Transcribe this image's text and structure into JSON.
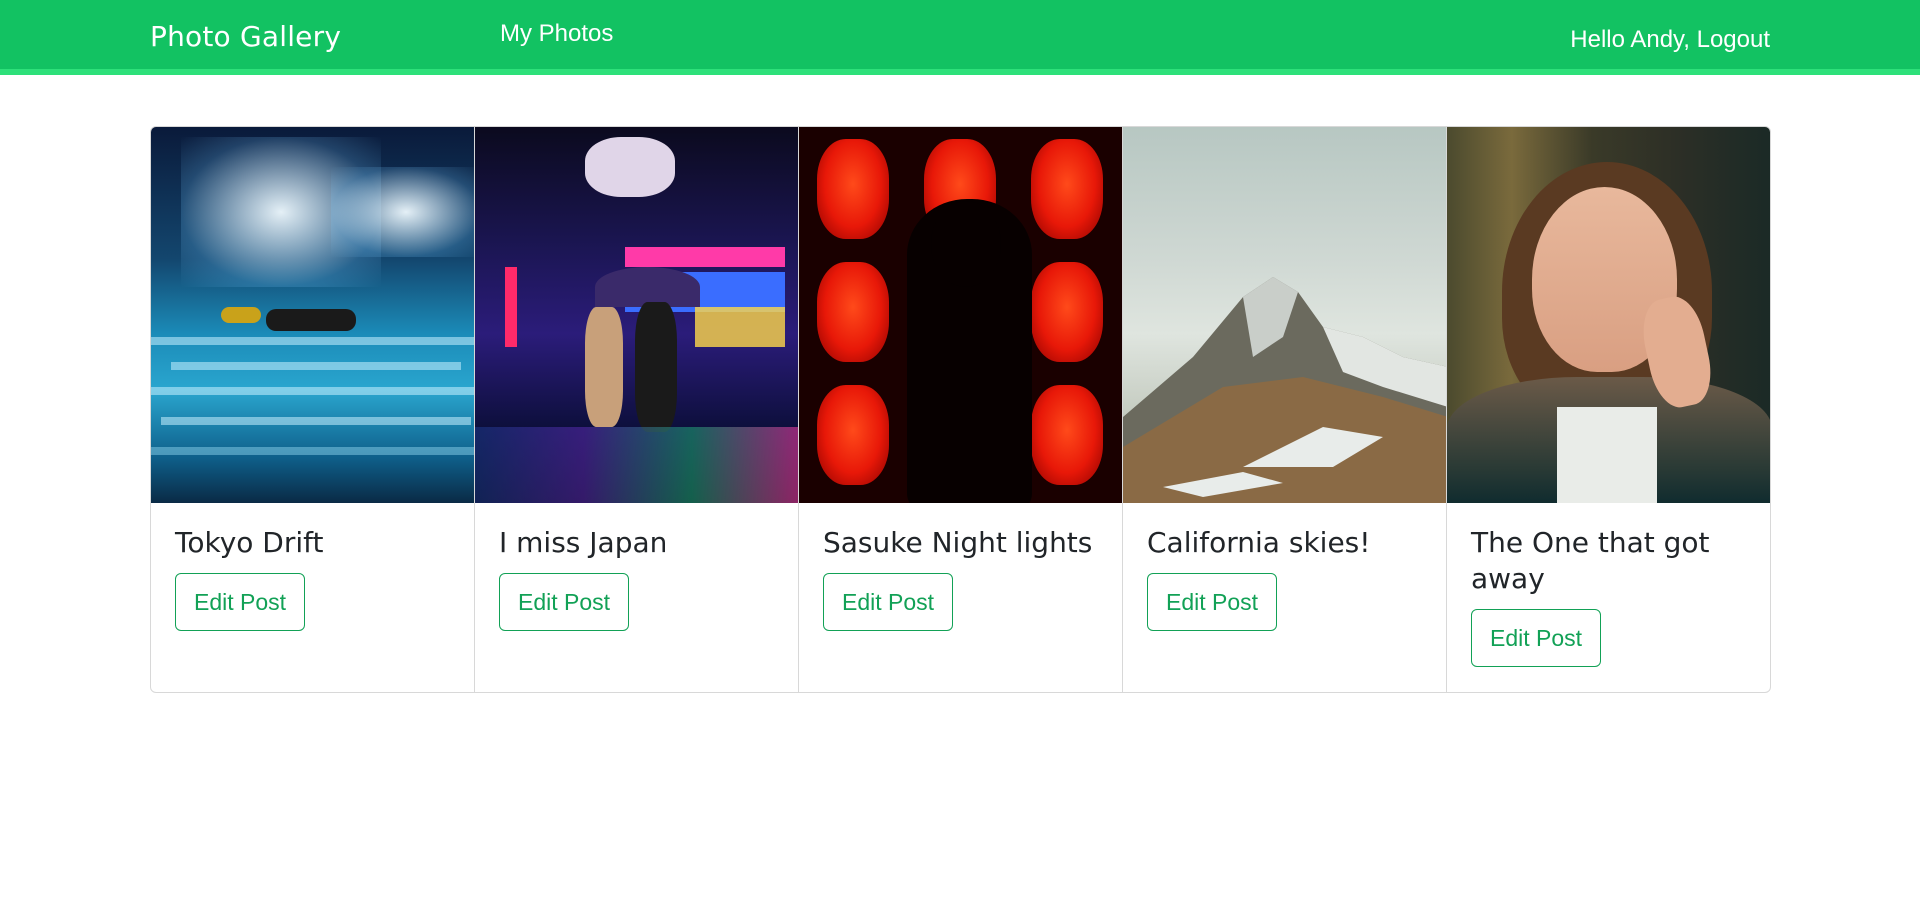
{
  "navbar": {
    "brand": "Photo Gallery",
    "my_photos": "My Photos",
    "user_greeting": "Hello Andy, Logout"
  },
  "colors": {
    "nav_background": "#12c262",
    "accent": "#12a156"
  },
  "cards": [
    {
      "title": "Tokyo Drift",
      "button": "Edit Post"
    },
    {
      "title": "I miss Japan",
      "button": "Edit Post"
    },
    {
      "title": "Sasuke Night lights",
      "button": "Edit Post"
    },
    {
      "title": "California skies!",
      "button": "Edit Post"
    },
    {
      "title": "The One that got away",
      "button": "Edit Post"
    }
  ]
}
